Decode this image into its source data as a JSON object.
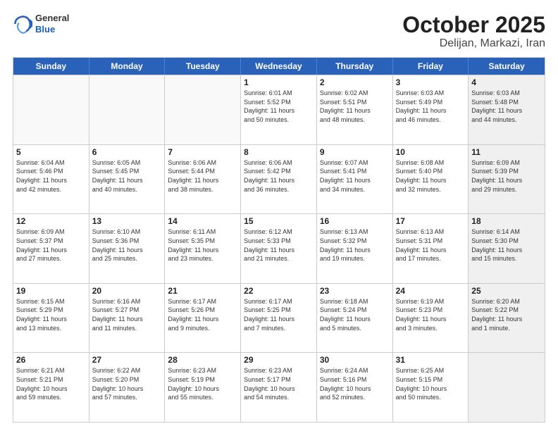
{
  "header": {
    "logo_general": "General",
    "logo_blue": "Blue",
    "title": "October 2025",
    "subtitle": "Delijan, Markazi, Iran"
  },
  "days_of_week": [
    "Sunday",
    "Monday",
    "Tuesday",
    "Wednesday",
    "Thursday",
    "Friday",
    "Saturday"
  ],
  "weeks": [
    [
      {
        "day": "",
        "info": "",
        "empty": true
      },
      {
        "day": "",
        "info": "",
        "empty": true
      },
      {
        "day": "",
        "info": "",
        "empty": true
      },
      {
        "day": "1",
        "info": "Sunrise: 6:01 AM\nSunset: 5:52 PM\nDaylight: 11 hours\nand 50 minutes.",
        "empty": false
      },
      {
        "day": "2",
        "info": "Sunrise: 6:02 AM\nSunset: 5:51 PM\nDaylight: 11 hours\nand 48 minutes.",
        "empty": false
      },
      {
        "day": "3",
        "info": "Sunrise: 6:03 AM\nSunset: 5:49 PM\nDaylight: 11 hours\nand 46 minutes.",
        "empty": false
      },
      {
        "day": "4",
        "info": "Sunrise: 6:03 AM\nSunset: 5:48 PM\nDaylight: 11 hours\nand 44 minutes.",
        "empty": false,
        "shaded": true
      }
    ],
    [
      {
        "day": "5",
        "info": "Sunrise: 6:04 AM\nSunset: 5:46 PM\nDaylight: 11 hours\nand 42 minutes.",
        "empty": false
      },
      {
        "day": "6",
        "info": "Sunrise: 6:05 AM\nSunset: 5:45 PM\nDaylight: 11 hours\nand 40 minutes.",
        "empty": false
      },
      {
        "day": "7",
        "info": "Sunrise: 6:06 AM\nSunset: 5:44 PM\nDaylight: 11 hours\nand 38 minutes.",
        "empty": false
      },
      {
        "day": "8",
        "info": "Sunrise: 6:06 AM\nSunset: 5:42 PM\nDaylight: 11 hours\nand 36 minutes.",
        "empty": false
      },
      {
        "day": "9",
        "info": "Sunrise: 6:07 AM\nSunset: 5:41 PM\nDaylight: 11 hours\nand 34 minutes.",
        "empty": false
      },
      {
        "day": "10",
        "info": "Sunrise: 6:08 AM\nSunset: 5:40 PM\nDaylight: 11 hours\nand 32 minutes.",
        "empty": false
      },
      {
        "day": "11",
        "info": "Sunrise: 6:09 AM\nSunset: 5:39 PM\nDaylight: 11 hours\nand 29 minutes.",
        "empty": false,
        "shaded": true
      }
    ],
    [
      {
        "day": "12",
        "info": "Sunrise: 6:09 AM\nSunset: 5:37 PM\nDaylight: 11 hours\nand 27 minutes.",
        "empty": false
      },
      {
        "day": "13",
        "info": "Sunrise: 6:10 AM\nSunset: 5:36 PM\nDaylight: 11 hours\nand 25 minutes.",
        "empty": false
      },
      {
        "day": "14",
        "info": "Sunrise: 6:11 AM\nSunset: 5:35 PM\nDaylight: 11 hours\nand 23 minutes.",
        "empty": false
      },
      {
        "day": "15",
        "info": "Sunrise: 6:12 AM\nSunset: 5:33 PM\nDaylight: 11 hours\nand 21 minutes.",
        "empty": false
      },
      {
        "day": "16",
        "info": "Sunrise: 6:13 AM\nSunset: 5:32 PM\nDaylight: 11 hours\nand 19 minutes.",
        "empty": false
      },
      {
        "day": "17",
        "info": "Sunrise: 6:13 AM\nSunset: 5:31 PM\nDaylight: 11 hours\nand 17 minutes.",
        "empty": false
      },
      {
        "day": "18",
        "info": "Sunrise: 6:14 AM\nSunset: 5:30 PM\nDaylight: 11 hours\nand 15 minutes.",
        "empty": false,
        "shaded": true
      }
    ],
    [
      {
        "day": "19",
        "info": "Sunrise: 6:15 AM\nSunset: 5:29 PM\nDaylight: 11 hours\nand 13 minutes.",
        "empty": false
      },
      {
        "day": "20",
        "info": "Sunrise: 6:16 AM\nSunset: 5:27 PM\nDaylight: 11 hours\nand 11 minutes.",
        "empty": false
      },
      {
        "day": "21",
        "info": "Sunrise: 6:17 AM\nSunset: 5:26 PM\nDaylight: 11 hours\nand 9 minutes.",
        "empty": false
      },
      {
        "day": "22",
        "info": "Sunrise: 6:17 AM\nSunset: 5:25 PM\nDaylight: 11 hours\nand 7 minutes.",
        "empty": false
      },
      {
        "day": "23",
        "info": "Sunrise: 6:18 AM\nSunset: 5:24 PM\nDaylight: 11 hours\nand 5 minutes.",
        "empty": false
      },
      {
        "day": "24",
        "info": "Sunrise: 6:19 AM\nSunset: 5:23 PM\nDaylight: 11 hours\nand 3 minutes.",
        "empty": false
      },
      {
        "day": "25",
        "info": "Sunrise: 6:20 AM\nSunset: 5:22 PM\nDaylight: 11 hours\nand 1 minute.",
        "empty": false,
        "shaded": true
      }
    ],
    [
      {
        "day": "26",
        "info": "Sunrise: 6:21 AM\nSunset: 5:21 PM\nDaylight: 10 hours\nand 59 minutes.",
        "empty": false
      },
      {
        "day": "27",
        "info": "Sunrise: 6:22 AM\nSunset: 5:20 PM\nDaylight: 10 hours\nand 57 minutes.",
        "empty": false
      },
      {
        "day": "28",
        "info": "Sunrise: 6:23 AM\nSunset: 5:19 PM\nDaylight: 10 hours\nand 55 minutes.",
        "empty": false
      },
      {
        "day": "29",
        "info": "Sunrise: 6:23 AM\nSunset: 5:17 PM\nDaylight: 10 hours\nand 54 minutes.",
        "empty": false
      },
      {
        "day": "30",
        "info": "Sunrise: 6:24 AM\nSunset: 5:16 PM\nDaylight: 10 hours\nand 52 minutes.",
        "empty": false
      },
      {
        "day": "31",
        "info": "Sunrise: 6:25 AM\nSunset: 5:15 PM\nDaylight: 10 hours\nand 50 minutes.",
        "empty": false
      },
      {
        "day": "",
        "info": "",
        "empty": true,
        "shaded": true
      }
    ]
  ]
}
